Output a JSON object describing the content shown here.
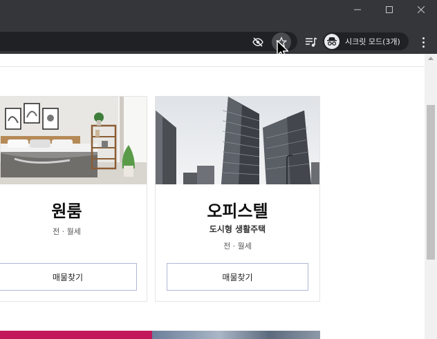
{
  "window": {
    "minimize_icon": "minimize-icon",
    "maximize_icon": "maximize-icon",
    "close_icon": "close-icon"
  },
  "toolbar": {
    "incognito_label": "시크릿 모드(3개)",
    "icons": [
      "eye-off-icon",
      "star-icon",
      "playlist-icon",
      "incognito-icon",
      "more-vert-icon"
    ]
  },
  "cards": [
    {
      "title": "원룸",
      "meta": "전 · 월세",
      "button": "매물찾기",
      "image": "bedroom-photo"
    },
    {
      "title": "오피스텔",
      "subtitle": "도시형 생활주택",
      "meta": "전 · 월세",
      "button": "매물찾기",
      "image": "office-building-photo"
    }
  ],
  "colors": {
    "chrome_bg": "#35363a",
    "omnibox_bg": "#202124",
    "button_border": "#aeb8d3",
    "accent_pink": "#c2185b"
  }
}
